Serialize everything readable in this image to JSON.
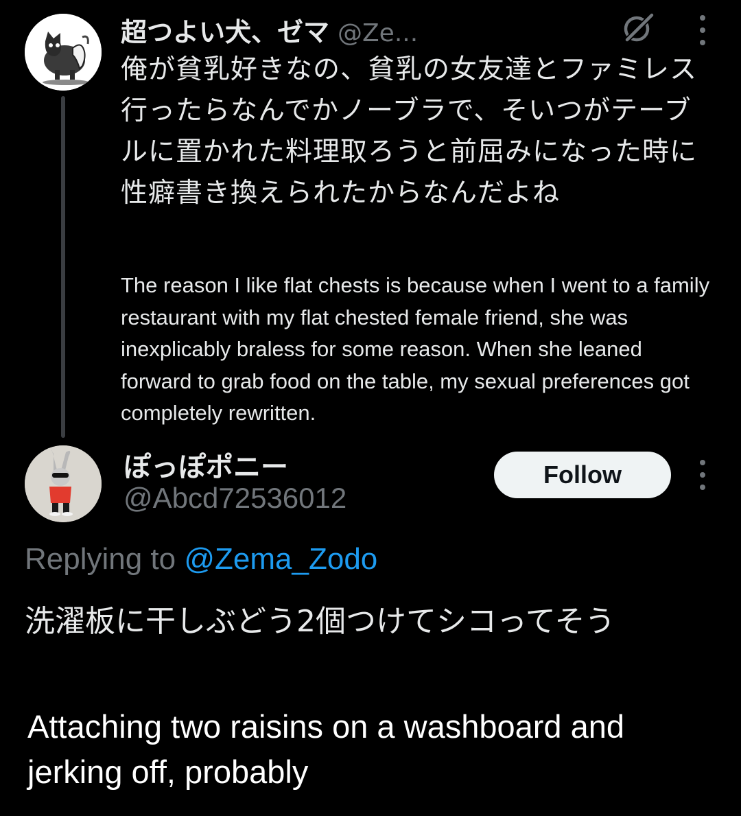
{
  "parent_tweet": {
    "display_name": "超つよい犬、ゼマ",
    "handle": "@Ze...",
    "avatar_icon": "cat-avatar",
    "text_jp": "俺が貧乳好きなの、貧乳の女友達とファミレス行ったらなんでかノーブラで、そいつがテーブルに置かれた料理取ろうと前屈みになった時に性癖書き換えられたからなんだよね",
    "text_en": "The reason I like flat chests is because when I went to a family restaurant with my flat chested female friend, she was inexplicably braless for some reason. When she leaned forward to grab food on the table, my sexual preferences got completely rewritten."
  },
  "reply_tweet": {
    "display_name": "ぽっぽポニー",
    "handle": "@Abcd72536012",
    "avatar_icon": "rabbit-avatar",
    "follow_label": "Follow",
    "replying_prefix": "Replying to ",
    "replying_to": "@Zema_Zodo",
    "text_jp": "洗濯板に干しぶどう2個つけてシコってそう",
    "text_en": "Attaching two raisins on a washboard and jerking off, probably"
  },
  "colors": {
    "background": "#000000",
    "text_primary": "#e7e9ea",
    "text_secondary": "#71767b",
    "link": "#1d9bf0",
    "follow_button_bg": "#eff3f4",
    "follow_button_text": "#0f1419"
  },
  "icons": [
    "grok-icon",
    "more-options-icon"
  ]
}
